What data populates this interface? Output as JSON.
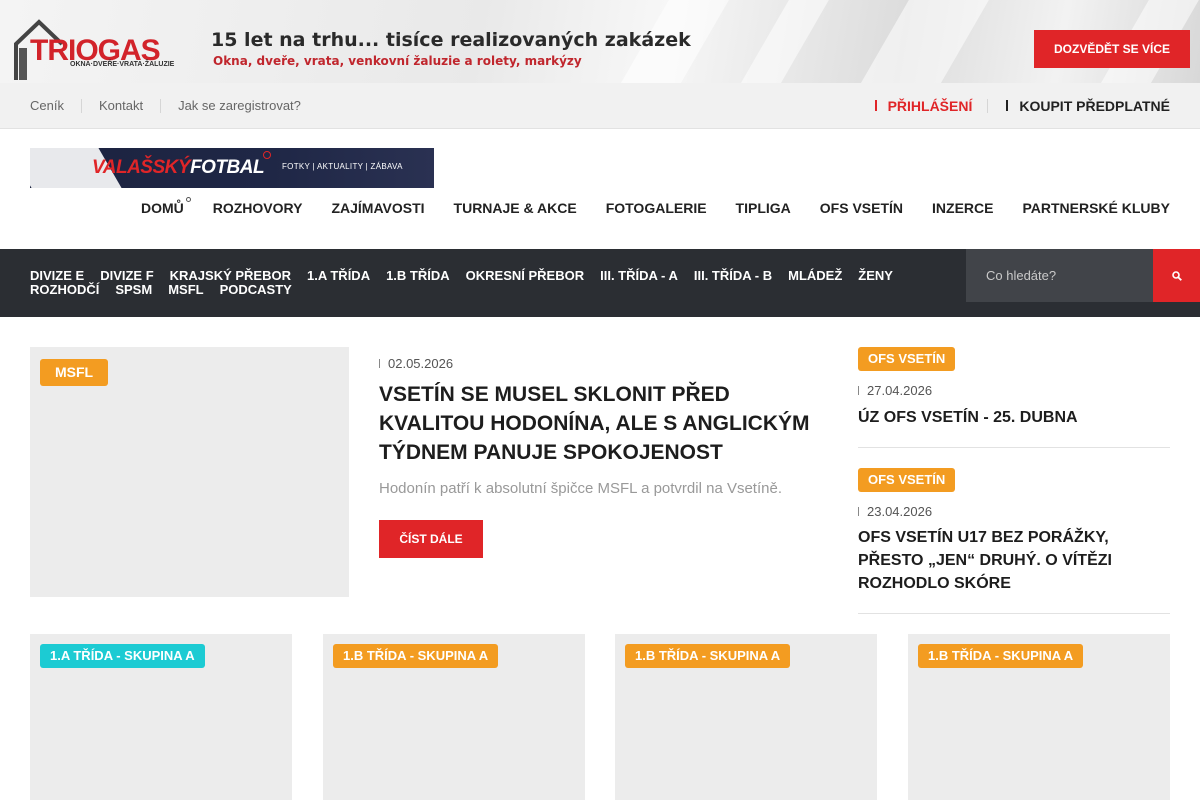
{
  "ad": {
    "brand": "TRIOGAS",
    "brand_sub": "OKNA·DVEŘE·VRATA·ŽALUZIE",
    "headline": "15 let na trhu... tisíce realizovaných zakázek",
    "subline": "Okna, dveře, vrata, venkovní žaluzie a rolety, markýzy",
    "cta": "DOZVĚDĚT SE VÍCE"
  },
  "topbar": {
    "links": [
      "Ceník",
      "Kontakt",
      "Jak se zaregistrovat?"
    ],
    "login": "PŘIHLÁŠENÍ",
    "buy": "KOUPIT PŘEDPLATNÉ"
  },
  "site": {
    "logo_name_red": "VALAŠSKÝ",
    "logo_name_white": "FOTBAL",
    "logo_tagline": "FOTKY | AKTUALITY | ZÁBAVA"
  },
  "mainnav": [
    "DOMŮ",
    "ROZHOVORY",
    "ZAJÍMAVOSTI",
    "TURNAJE & AKCE",
    "FOTOGALERIE",
    "TIPLIGA",
    "OFS VSETÍN",
    "INZERCE",
    "PARTNERSKÉ KLUBY"
  ],
  "categories": [
    "DIVIZE E",
    "DIVIZE F",
    "KRAJSKÝ PŘEBOR",
    "1.A TŘÍDA",
    "1.B TŘÍDA",
    "OKRESNÍ PŘEBOR",
    "III. TŘÍDA - A",
    "III. TŘÍDA - B",
    "MLÁDEŽ",
    "ŽENY",
    "ROZHODČÍ",
    "SPSM",
    "MSFL",
    "PODCASTY"
  ],
  "search": {
    "placeholder": "Co hledáte?"
  },
  "featured": {
    "badge": "MSFL",
    "date": "02.05.2026",
    "title": "VSETÍN SE MUSEL SKLONIT PŘED KVALITOU HODONÍNA, ALE S ANGLICKÝM TÝDNEM PANUJE SPOKOJENOST",
    "excerpt": "Hodonín patří k absolutní špičce MSFL a potvrdil na Vsetíně.",
    "read_more": "ČÍST DÁLE"
  },
  "sidebar": [
    {
      "badge": "OFS VSETÍN",
      "date": "27.04.2026",
      "title": "ÚZ OFS VSETÍN - 25. DUBNA"
    },
    {
      "badge": "OFS VSETÍN",
      "date": "23.04.2026",
      "title": "OFS VSETÍN U17 BEZ PORÁŽKY, PŘESTO „JEN“ DRUHÝ. O VÍTĚZI ROZHODLO SKÓRE"
    }
  ],
  "cards": [
    {
      "badge": "1.A TŘÍDA - SKUPINA A",
      "color": "#1ccbd3"
    },
    {
      "badge": "1.B TŘÍDA - SKUPINA A",
      "color": "#f39c21"
    },
    {
      "badge": "1.B TŘÍDA - SKUPINA A",
      "color": "#f39c21"
    },
    {
      "badge": "1.B TŘÍDA - SKUPINA A",
      "color": "#f39c21"
    }
  ],
  "colors": {
    "accent": "#e02528",
    "badge_orange": "#f39c21",
    "badge_teal": "#1ccbd3",
    "dark_bar": "#2b2e33"
  }
}
